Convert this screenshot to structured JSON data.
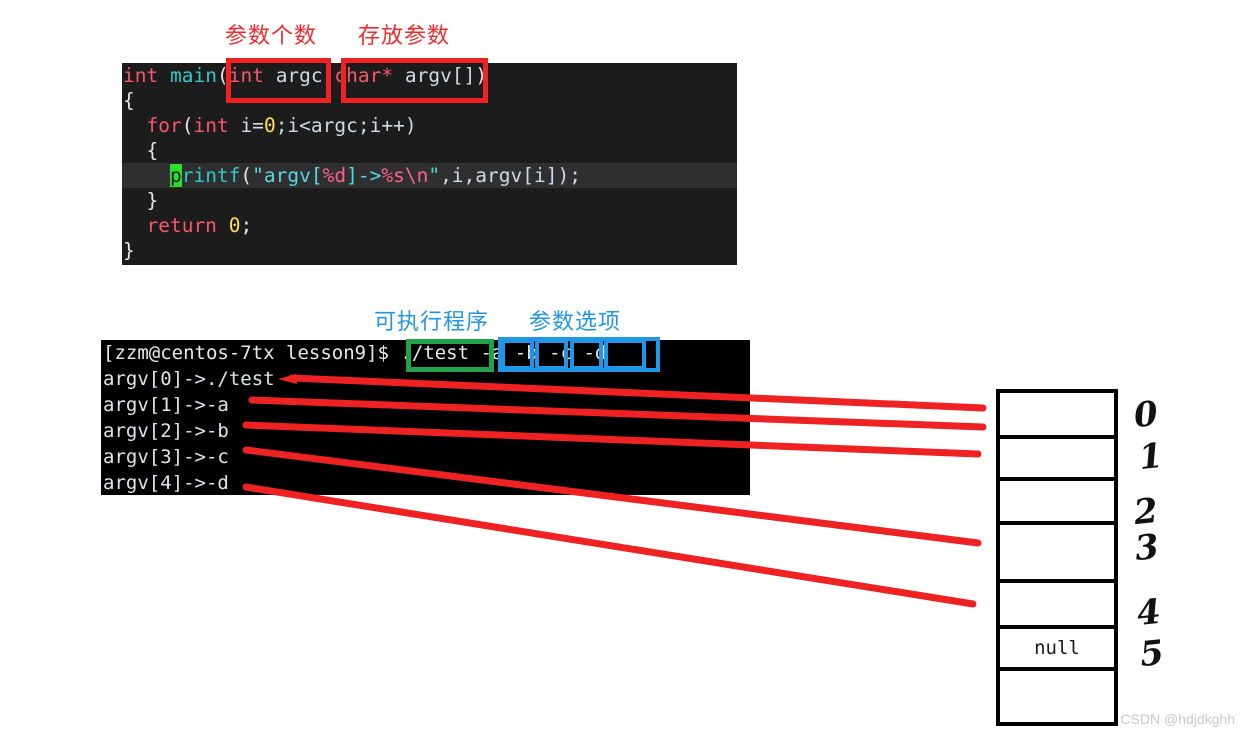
{
  "annotations": {
    "argc_label": "参数个数",
    "argv_label": "存放参数",
    "program_label": "可执行程序",
    "options_label": "参数选项"
  },
  "code": {
    "language": "c",
    "lines": [
      {
        "id": "signature",
        "tokens": [
          {
            "text": "int",
            "cls": "c-kw"
          },
          {
            "text": " ",
            "cls": "c-punct"
          },
          {
            "text": "main",
            "cls": "c-fn"
          },
          {
            "text": "(",
            "cls": "c-punct"
          },
          {
            "text": "int",
            "cls": "c-kw"
          },
          {
            "text": " ",
            "cls": "c-punct"
          },
          {
            "text": "argc",
            "cls": "c-var"
          },
          {
            "text": ",",
            "cls": "c-punct"
          },
          {
            "text": "char",
            "cls": "c-kw"
          },
          {
            "text": "*",
            "cls": "c-kw"
          },
          {
            "text": " ",
            "cls": "c-punct"
          },
          {
            "text": "argv[]",
            "cls": "c-var"
          },
          {
            "text": ")",
            "cls": "c-punct"
          }
        ]
      },
      {
        "id": "open-brace",
        "tokens": [
          {
            "text": "{",
            "cls": "c-punct"
          }
        ]
      },
      {
        "id": "for-loop",
        "tokens": [
          {
            "text": "  ",
            "cls": "c-punct"
          },
          {
            "text": "for",
            "cls": "c-kw"
          },
          {
            "text": "(",
            "cls": "c-punct"
          },
          {
            "text": "int",
            "cls": "c-kw"
          },
          {
            "text": " i=",
            "cls": "c-var"
          },
          {
            "text": "0",
            "cls": "c-num"
          },
          {
            "text": ";i<argc;i++)",
            "cls": "c-var"
          }
        ]
      },
      {
        "id": "loop-open-brace",
        "tokens": [
          {
            "text": "  {",
            "cls": "c-punct"
          }
        ]
      },
      {
        "id": "printf",
        "highlight": true,
        "tokens": [
          {
            "text": "    ",
            "cls": "c-punct"
          },
          {
            "text": "p",
            "cls": "c-cursor"
          },
          {
            "text": "rintf",
            "cls": "c-fn"
          },
          {
            "text": "(",
            "cls": "c-punct"
          },
          {
            "text": "\"argv[",
            "cls": "c-str"
          },
          {
            "text": "%d",
            "cls": "c-fmt"
          },
          {
            "text": "]->",
            "cls": "c-str"
          },
          {
            "text": "%s",
            "cls": "c-fmt"
          },
          {
            "text": "\\n",
            "cls": "c-fmt"
          },
          {
            "text": "\"",
            "cls": "c-str"
          },
          {
            "text": ",i,argv[i]);",
            "cls": "c-var"
          }
        ]
      },
      {
        "id": "loop-close-brace",
        "tokens": [
          {
            "text": "  }",
            "cls": "c-punct"
          }
        ]
      },
      {
        "id": "return",
        "tokens": [
          {
            "text": "  ",
            "cls": "c-punct"
          },
          {
            "text": "return",
            "cls": "c-kw"
          },
          {
            "text": " ",
            "cls": "c-punct"
          },
          {
            "text": "0",
            "cls": "c-num"
          },
          {
            "text": ";",
            "cls": "c-punct"
          }
        ]
      },
      {
        "id": "close-brace",
        "tokens": [
          {
            "text": "}",
            "cls": "c-punct"
          }
        ]
      }
    ]
  },
  "terminal": {
    "prompt": "[zzm@centos-7tx lesson9]$ ",
    "command": "./test -a -b -c -d",
    "command_program": "./test",
    "command_options": [
      "-a",
      "-b",
      "-c",
      "-d"
    ],
    "output_lines": [
      "argv[0]->./test",
      "argv[1]->-a",
      "argv[2]->-b",
      "argv[3]->-c",
      "argv[4]->-d"
    ]
  },
  "array_table": {
    "cells": [
      {
        "index": "0",
        "value": ""
      },
      {
        "index": "1",
        "value": ""
      },
      {
        "index": "2",
        "value": ""
      },
      {
        "index": "3",
        "value": ""
      },
      {
        "index": "4",
        "value": ""
      },
      {
        "index": "5",
        "value": "null"
      },
      {
        "index": "",
        "value": ""
      }
    ]
  },
  "watermark": "CSDN @hdjdkghh",
  "colors": {
    "red": "#ef2222",
    "green": "#22a14a",
    "blue": "#2196e8",
    "code_bg": "#1c1c1c",
    "terminal_bg": "#000000"
  }
}
